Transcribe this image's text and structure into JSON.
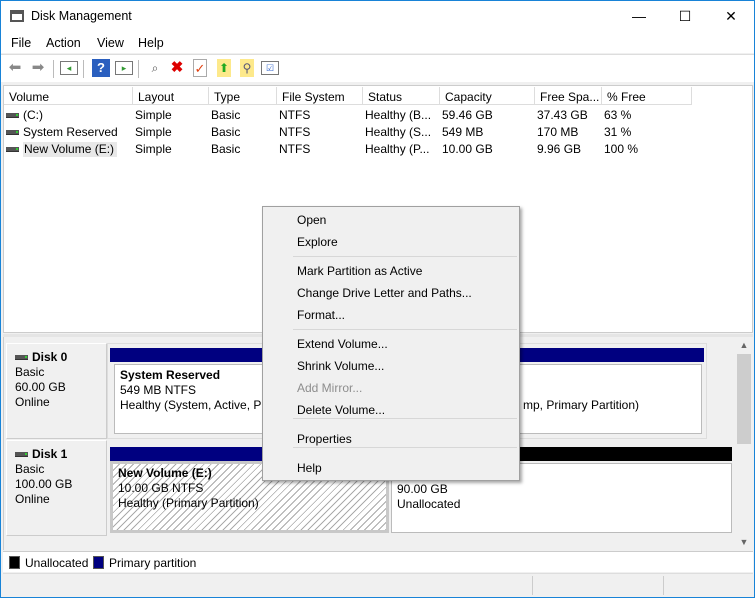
{
  "window": {
    "title": "Disk Management",
    "controls": {
      "minimize": "—",
      "maximize": "☐",
      "close": "✕"
    }
  },
  "menubar": [
    "File",
    "Action",
    "View",
    "Help"
  ],
  "toolbar": [
    "back-icon",
    "forward-icon",
    "console-tree-icon",
    "help-icon",
    "action-pane-icon",
    "connect-disk-icon",
    "delete-icon",
    "properties-icon",
    "up-folder-icon",
    "search-folder-icon",
    "checklist-icon"
  ],
  "volume_list": {
    "columns": [
      "Volume",
      "Layout",
      "Type",
      "File System",
      "Status",
      "Capacity",
      "Free Spa...",
      "% Free"
    ],
    "rows": [
      [
        "(C:)",
        "Simple",
        "Basic",
        "NTFS",
        "Healthy (B...",
        "59.46 GB",
        "37.43 GB",
        "63 %"
      ],
      [
        "System Reserved",
        "Simple",
        "Basic",
        "NTFS",
        "Healthy (S...",
        "549 MB",
        "170 MB",
        "31 %"
      ],
      [
        "New Volume (E:)",
        "Simple",
        "Basic",
        "NTFS",
        "Healthy (P...",
        "10.00 GB",
        "9.96 GB",
        "100 %"
      ]
    ],
    "selected_row": 2
  },
  "disks": [
    {
      "name": "Disk 0",
      "type": "Basic",
      "size": "60.00 GB",
      "state": "Online",
      "partitions": [
        {
          "name": "System Reserved",
          "size": "549 MB NTFS",
          "status": "Healthy (System, Active, Pri"
        },
        {
          "status_fragment": "mp, Primary Partition)"
        }
      ]
    },
    {
      "name": "Disk 1",
      "type": "Basic",
      "size": "100.00 GB",
      "state": "Online",
      "partitions": [
        {
          "name": "New Volume  (E:)",
          "size": "10.00 GB NTFS",
          "status": "Healthy (Primary Partition)"
        },
        {
          "size": "90.00 GB",
          "status": "Unallocated"
        }
      ]
    }
  ],
  "legend": [
    {
      "label": "Unallocated",
      "color": "#000000"
    },
    {
      "label": "Primary partition",
      "color": "#000080"
    }
  ],
  "context_menu": {
    "items": [
      {
        "label": "Open",
        "enabled": true
      },
      {
        "label": "Explore",
        "enabled": true
      },
      {
        "label": "Mark Partition as Active",
        "enabled": true
      },
      {
        "label": "Change Drive Letter and Paths...",
        "enabled": true
      },
      {
        "label": "Format...",
        "enabled": true
      },
      {
        "label": "Extend Volume...",
        "enabled": true
      },
      {
        "label": "Shrink Volume...",
        "enabled": true
      },
      {
        "label": "Add Mirror...",
        "enabled": false
      },
      {
        "label": "Delete Volume...",
        "enabled": true
      },
      {
        "label": "Properties",
        "enabled": true
      },
      {
        "label": "Help",
        "enabled": true
      }
    ]
  },
  "colors": {
    "primary": "#000080",
    "unallocated": "#000000",
    "accent": "#1883d7"
  }
}
